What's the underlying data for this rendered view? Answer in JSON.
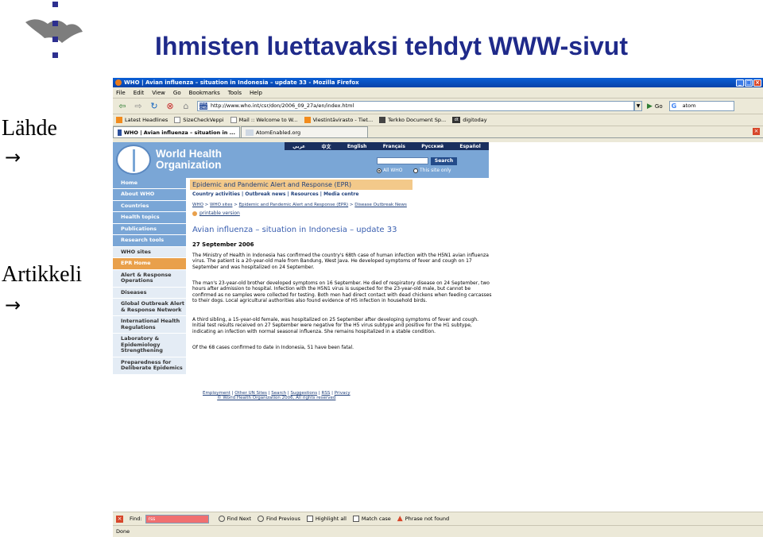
{
  "slide": {
    "title": "Ihmisten luettavaksi tehdyt WWW-sivut",
    "label_1": "Lähde",
    "label_2": "Artikkeli",
    "arrow": "→"
  },
  "browser": {
    "window_title": "WHO | Avian influenza – situation in Indonesia – update 33 - Mozilla Firefox",
    "window_buttons": [
      "_",
      "□",
      "×"
    ],
    "menu": [
      "File",
      "Edit",
      "View",
      "Go",
      "Bookmarks",
      "Tools",
      "Help"
    ],
    "url_favicon": "WHO OMS",
    "url": "http://www.who.int/csr/don/2006_09_27a/en/index.html",
    "go_label": "Go",
    "search_value": "atom",
    "bookmarks": [
      {
        "label": "Latest Headlines",
        "icon": "rss-icon"
      },
      {
        "label": "SizeCheckVeppi",
        "icon": "page-icon"
      },
      {
        "label": "Mail :: Welcome to W...",
        "icon": "page-icon"
      },
      {
        "label": "Viestintävirasto - Tiet...",
        "icon": "rss-icon"
      },
      {
        "label": "Terkko Document Sp...",
        "icon": "dark-icon"
      },
      {
        "label": "digitoday",
        "icon": "dt-icon",
        "badge": "dt"
      }
    ],
    "tabs": [
      {
        "label": "WHO | Avian influenza – situation in ...",
        "active": true
      },
      {
        "label": "AtomEnabled.org",
        "active": false
      }
    ],
    "find": {
      "label": "Find:",
      "value": "rss",
      "next": "Find Next",
      "previous": "Find Previous",
      "highlight": "Highlight all",
      "match_case": "Match case",
      "message": "Phrase not found"
    },
    "status": "Done"
  },
  "who": {
    "name_line1": "World Health",
    "name_line2": "Organization",
    "languages": [
      "عربي",
      "中文",
      "English",
      "Français",
      "Русский",
      "Español"
    ],
    "search_button": "Search",
    "radio_all": "All WHO",
    "radio_site": "This site only",
    "nav": [
      {
        "label": "Home",
        "style": "dark"
      },
      {
        "label": "About WHO",
        "style": "dark"
      },
      {
        "label": "Countries",
        "style": "dark"
      },
      {
        "label": "Health topics",
        "style": "dark"
      },
      {
        "label": "Publications",
        "style": "dark"
      },
      {
        "label": "Research tools",
        "style": "dark"
      },
      {
        "label": "WHO sites",
        "style": "light"
      },
      {
        "label": "EPR Home",
        "style": "orange"
      },
      {
        "label": "Alert & Response Operations",
        "style": "light"
      },
      {
        "label": "Diseases",
        "style": "light"
      },
      {
        "label": "Global Outbreak Alert & Response Network",
        "style": "light"
      },
      {
        "label": "International Health Regulations",
        "style": "light"
      },
      {
        "label": "Laboratory & Epidemiology Strengthening",
        "style": "light"
      },
      {
        "label": "Preparedness for Deliberate Epidemics",
        "style": "light"
      }
    ],
    "section_title": "Epidemic and Pandemic Alert and Response (EPR)",
    "subnav": [
      "Country activities",
      "Outbreak news",
      "Resources",
      "Media centre"
    ],
    "breadcrumbs": [
      "WHO",
      "WHO sites",
      "Epidemic and Pandemic Alert and Response (EPR)",
      "Disease Outbreak News"
    ],
    "printable": "printable version",
    "article_title": "Avian influenza – situation in Indonesia – update 33",
    "article_date": "27 September 2006",
    "paragraphs": [
      "The Ministry of Health in Indonesia has confirmed the country's 68th case of human infection with the H5N1 avian influenza virus. The patient is a 20-year-old male from Bandung, West Java. He developed symptoms of fever and cough on 17 September and was hospitalized on 24 September.",
      "The man's 23-year-old brother developed symptoms on 16 September. He died of respiratory disease on 24 September, two hours after admission to hospital. Infection with the H5N1 virus is suspected for the 23-year-old male, but cannot be confirmed as no samples were collected for testing. Both men had direct contact with dead chickens when feeding carcasses to their dogs. Local agricultural authorities also found evidence of H5 infection in household birds.",
      "A third sibling, a 15-year-old female, was hospitalized on 25 September after developing symptoms of fever and cough. Initial test results received on 27 September were negative for the H5 virus subtype and positive for the H1 subtype, indicating an infection with normal seasonal influenza. She remains hospitalized in a stable condition.",
      "Of the 68 cases confirmed to date in Indonesia, 51 have been fatal."
    ],
    "footer_links": [
      "Employment",
      "Other UN Sites",
      "Search",
      "Suggestions",
      "RSS",
      "Privacy"
    ],
    "copyright": "© World Health Organization 2006, All rights reserved"
  }
}
